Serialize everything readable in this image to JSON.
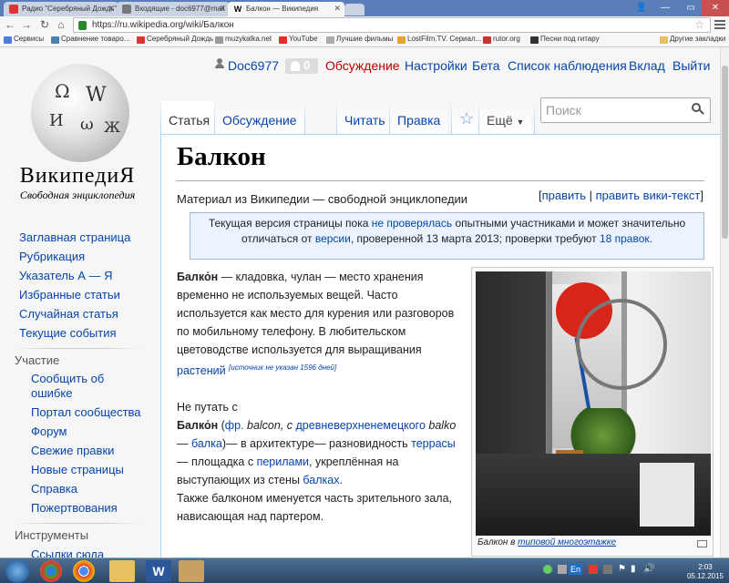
{
  "browser": {
    "tabs": [
      {
        "label": "Радио \"Серебряный Дождь\"",
        "active": false
      },
      {
        "label": "Входящие - doc6977@mail",
        "active": false
      },
      {
        "label": "Балкон — Википедия",
        "active": true
      }
    ],
    "url": "https://ru.wikipedia.org/wiki/Балкон",
    "bookmarks": [
      "Сервисы",
      "Сравнение товаро...",
      "Серебряный Дождь",
      "muzykalka.net",
      "YouTube",
      "Лучшие фильмы",
      "LostFilm.TV. Сериал...",
      "rutor.org",
      "Песни под гитару",
      "Другие закладки"
    ],
    "colors": {
      "tabstrip": "#5a7fb8",
      "youtube": "#e52d27",
      "close": "#c75050"
    }
  },
  "sidebar": {
    "wordmark": "ВикипедиЯ",
    "tagline": "Свободная энциклопедия",
    "main_items": [
      "Заглавная страница",
      "Рубрикация",
      "Указатель А — Я",
      "Избранные статьи",
      "Случайная статья",
      "Текущие события"
    ],
    "participation_heading": "Участие",
    "participation_items": [
      "Сообщить об ошибке",
      "Портал сообщества",
      "Форум",
      "Свежие правки",
      "Новые страницы",
      "Справка",
      "Пожертвования"
    ],
    "tools_heading": "Инструменты",
    "tools_items": [
      "Ссылки сюда"
    ]
  },
  "personal": {
    "username": "Doc6977",
    "notifications": "0",
    "links": [
      "Обсуждение",
      "Настройки",
      "Бета",
      "Список наблюдения",
      "Вклад",
      "Выйти"
    ]
  },
  "tabs": {
    "article": "Статья",
    "talk": "Обсуждение",
    "read": "Читать",
    "edit": "Правка",
    "more": "Ещё",
    "search_placeholder": "Поиск"
  },
  "article": {
    "title": "Балкон",
    "site_sub": "Материал из Википедии — свободной энциклопедии",
    "edit_link": "править",
    "edit_wiki_link": "править вики-текст",
    "flagged": {
      "t1": "Текущая версия страницы пока ",
      "l1": "не проверялась",
      "t2": " опытными участниками и может значительно отличаться от ",
      "l2": "версии",
      "t3": ", проверенной 13 марта 2013; проверки требуют ",
      "l3": "18 правок",
      "t4": "."
    },
    "p1": {
      "bold": "Балко́н",
      "t1": " — кладовка, чулан — место хранения временно не используемых вещей. Часто используется как место для курения или разговоров по мобильному телефону. В любительском цветоводстве используется для выращивания ",
      "link": "растений",
      "cite": "[источник не указан 1596 дней]"
    },
    "p2": {
      "t0": "Не путать с",
      "bold": "Балко́н",
      "t1": " (",
      "l1": "фр.",
      "t2": " balcon, с ",
      "l2": "древневерхненемецкого",
      "t3": " ",
      "it": "balko",
      "t4": " — ",
      "l3": "балка",
      "t5": ")— в архитектуре— разновидность ",
      "l4": "террасы",
      "t6": "— площадка с ",
      "l5": "перилами",
      "t7": ", укреплённая на выступающих из стены ",
      "l6": "балках",
      "t8": ".",
      "t9": "Также балконом именуется часть зрительного зала, нависающая над партером."
    },
    "caption_t": "Балкон в ",
    "caption_link": "типовой многоэтажке"
  },
  "taskbar": {
    "lang": "En",
    "time": "2:03",
    "date": "05.12.2015"
  }
}
